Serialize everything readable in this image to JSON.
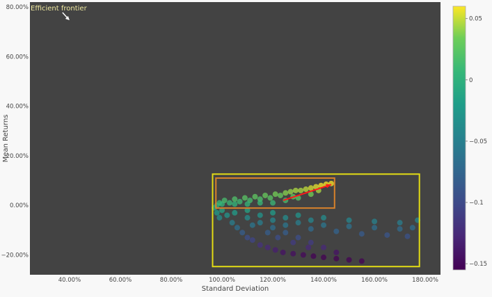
{
  "chart_data": {
    "type": "scatter",
    "title": "",
    "xlabel": "Standard Deviation",
    "ylabel": "Mean Returns",
    "xlim": [
      24.4,
      186
    ],
    "ylim": [
      -28,
      82
    ],
    "xticks": [
      40,
      60,
      80,
      100,
      120,
      140,
      160,
      180
    ],
    "xtick_labels": [
      "40.00%",
      "60.00%",
      "80.00%",
      "100.00%",
      "120.00%",
      "140.00%",
      "160.00%",
      "180.00%"
    ],
    "yticks": [
      -20,
      0,
      20,
      40,
      60,
      80
    ],
    "ytick_labels": [
      "−20.00%",
      "0.00%",
      "20.00%",
      "40.00%",
      "60.00%",
      "80.00%"
    ],
    "grid": false,
    "colors": {
      "plot_bg": "#434343",
      "paper_bg": "#f8f8f8",
      "outer_box": "#e3dc14",
      "inner_box": "#d9822b",
      "arrow": "#ff1a1a",
      "annotation": "#f0eaa0"
    },
    "colorbar": {
      "range": [
        -0.155,
        0.06
      ],
      "ticks": [
        0.05,
        0,
        -0.05,
        -0.1,
        -0.15
      ],
      "tick_labels": [
        "0.05",
        "0",
        "−0.05",
        "−0.1",
        "−0.15"
      ],
      "colorscale": "viridis"
    },
    "annotation": {
      "text": "Efficient frontier",
      "arrow_to": [
        39.7,
        75
      ]
    },
    "shapes": [
      {
        "type": "rect",
        "name": "outer-region",
        "x0": 96.3,
        "x1": 177.7,
        "y0": -24.7,
        "y1": 12.6,
        "color": "#e3dc14"
      },
      {
        "type": "rect",
        "name": "efficient-region",
        "x0": 97.6,
        "x1": 144.3,
        "y0": -1.1,
        "y1": 11,
        "color": "#d9822b"
      },
      {
        "type": "arrow",
        "name": "frontier-arrow",
        "x0": 124.1,
        "y0": 2,
        "x1": 143,
        "y1": 8.4,
        "color": "#ff1a1a"
      }
    ],
    "points": [
      [
        98,
        0,
        0.0
      ],
      [
        99,
        1,
        0.008
      ],
      [
        100,
        0.5,
        0.004
      ],
      [
        101,
        2,
        0.015
      ],
      [
        103,
        1,
        0.008
      ],
      [
        105,
        2.5,
        0.019
      ],
      [
        107,
        1.5,
        0.011
      ],
      [
        109,
        3,
        0.023
      ],
      [
        111,
        2,
        0.015
      ],
      [
        113,
        3.5,
        0.026
      ],
      [
        115,
        2.5,
        0.019
      ],
      [
        117,
        4,
        0.03
      ],
      [
        119,
        3,
        0.023
      ],
      [
        121,
        4.5,
        0.034
      ],
      [
        123,
        4,
        0.03
      ],
      [
        125,
        5,
        0.038
      ],
      [
        127,
        5.5,
        0.041
      ],
      [
        129,
        6,
        0.045
      ],
      [
        131,
        6,
        0.045
      ],
      [
        133,
        6.5,
        0.049
      ],
      [
        135,
        7,
        0.053
      ],
      [
        137,
        7.5,
        0.056
      ],
      [
        139,
        8,
        0.06
      ],
      [
        141,
        8.5,
        0.06
      ],
      [
        143,
        8.8,
        0.06
      ],
      [
        120,
        1,
        0.008
      ],
      [
        125,
        2,
        0.015
      ],
      [
        130,
        3,
        0.023
      ],
      [
        135,
        4.5,
        0.034
      ],
      [
        110,
        0.5,
        0.004
      ],
      [
        115,
        1,
        0.008
      ],
      [
        105,
        0.5,
        0.004
      ],
      [
        128,
        3.5,
        0.026
      ],
      [
        138,
        6,
        0.045
      ],
      [
        97,
        -1,
        -0.008
      ],
      [
        98,
        -3,
        -0.023
      ],
      [
        99,
        -5,
        -0.038
      ],
      [
        100,
        -2,
        -0.015
      ],
      [
        102,
        -4,
        -0.03
      ],
      [
        104,
        -7,
        -0.053
      ],
      [
        106,
        -9,
        -0.068
      ],
      [
        108,
        -11,
        -0.083
      ],
      [
        110,
        -13,
        -0.098
      ],
      [
        112,
        -14,
        -0.105
      ],
      [
        115,
        -16,
        -0.12
      ],
      [
        118,
        -17,
        -0.128
      ],
      [
        121,
        -18,
        -0.135
      ],
      [
        124,
        -19,
        -0.143
      ],
      [
        128,
        -19.5,
        -0.146
      ],
      [
        132,
        -20,
        -0.15
      ],
      [
        136,
        -20.5,
        -0.154
      ],
      [
        140,
        -21,
        -0.155
      ],
      [
        145,
        -21.5,
        -0.155
      ],
      [
        150,
        -22,
        -0.155
      ],
      [
        155,
        -22.5,
        -0.155
      ],
      [
        105,
        -3,
        -0.023
      ],
      [
        110,
        -5,
        -0.038
      ],
      [
        115,
        -7,
        -0.053
      ],
      [
        120,
        -9,
        -0.068
      ],
      [
        125,
        -11,
        -0.083
      ],
      [
        130,
        -13,
        -0.098
      ],
      [
        135,
        -15,
        -0.113
      ],
      [
        140,
        -17,
        -0.128
      ],
      [
        145,
        -19,
        -0.143
      ],
      [
        110,
        -2,
        -0.015
      ],
      [
        120,
        -3,
        -0.023
      ],
      [
        130,
        -4,
        -0.03
      ],
      [
        140,
        -5,
        -0.038
      ],
      [
        150,
        -6,
        -0.045
      ],
      [
        160,
        -6.5,
        -0.049
      ],
      [
        170,
        -7,
        -0.053
      ],
      [
        177,
        -6,
        -0.045
      ],
      [
        120,
        -6,
        -0.045
      ],
      [
        130,
        -7,
        -0.053
      ],
      [
        140,
        -8,
        -0.06
      ],
      [
        150,
        -8.5,
        -0.064
      ],
      [
        160,
        -9,
        -0.068
      ],
      [
        170,
        -9.5,
        -0.071
      ],
      [
        175,
        -9,
        -0.068
      ],
      [
        125,
        -8,
        -0.06
      ],
      [
        135,
        -9.5,
        -0.071
      ],
      [
        145,
        -10.5,
        -0.079
      ],
      [
        155,
        -11.5,
        -0.086
      ],
      [
        165,
        -12,
        -0.09
      ],
      [
        173,
        -12.5,
        -0.094
      ],
      [
        112,
        -8,
        -0.06
      ],
      [
        118,
        -11,
        -0.083
      ],
      [
        122,
        -13,
        -0.098
      ],
      [
        128,
        -15,
        -0.113
      ],
      [
        134,
        -17,
        -0.128
      ],
      [
        115,
        -4,
        -0.03
      ],
      [
        125,
        -5,
        -0.038
      ],
      [
        135,
        -6,
        -0.045
      ]
    ]
  }
}
